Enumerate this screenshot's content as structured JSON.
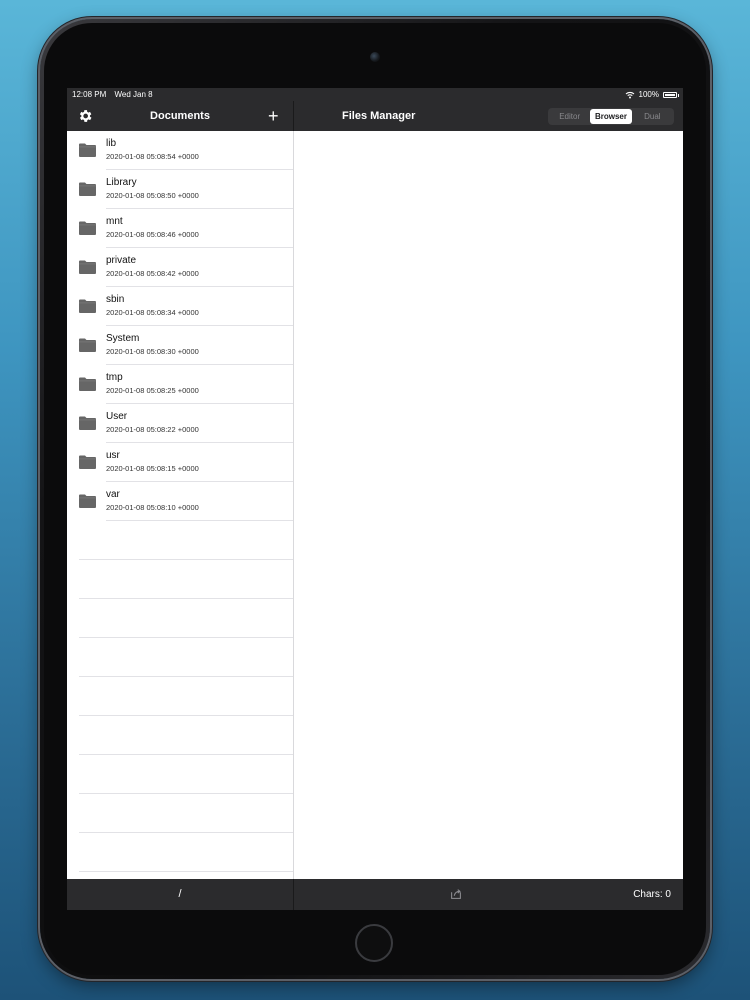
{
  "status": {
    "time": "12:08 PM",
    "date": "Wed Jan 8",
    "battery": "100%"
  },
  "sidebar": {
    "title": "Documents",
    "items": [
      {
        "name": "lib",
        "date": "2020-01-08 05:08:54 +0000"
      },
      {
        "name": "Library",
        "date": "2020-01-08 05:08:50 +0000"
      },
      {
        "name": "mnt",
        "date": "2020-01-08 05:08:46 +0000"
      },
      {
        "name": "private",
        "date": "2020-01-08 05:08:42 +0000"
      },
      {
        "name": "sbin",
        "date": "2020-01-08 05:08:34 +0000"
      },
      {
        "name": "System",
        "date": "2020-01-08 05:08:30 +0000"
      },
      {
        "name": "tmp",
        "date": "2020-01-08 05:08:25 +0000"
      },
      {
        "name": "User",
        "date": "2020-01-08 05:08:22 +0000"
      },
      {
        "name": "usr",
        "date": "2020-01-08 05:08:15 +0000"
      },
      {
        "name": "var",
        "date": "2020-01-08 05:08:10 +0000"
      }
    ]
  },
  "main": {
    "title": "Files Manager",
    "segments": [
      "Editor",
      "Browser",
      "Dual"
    ],
    "selected_segment": "Browser"
  },
  "toolbar": {
    "path": "/",
    "chars": "Chars: 0"
  },
  "icons": {
    "settings": "gear-icon",
    "add": "plus-icon",
    "folder": "folder-icon",
    "share": "share-icon",
    "wifi": "wifi-icon",
    "battery": "battery-icon"
  },
  "colors": {
    "bar": "#2b2b2d",
    "folder": "#666666"
  }
}
